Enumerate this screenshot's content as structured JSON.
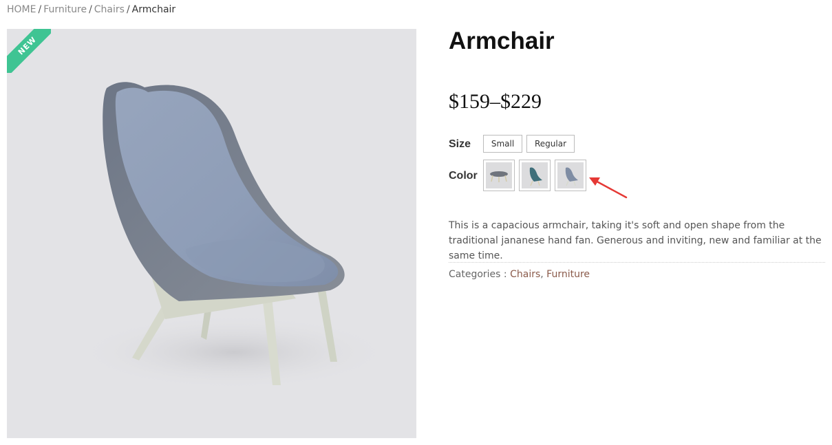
{
  "breadcrumb": {
    "items": [
      "HOME",
      "Furniture",
      "Chairs"
    ],
    "current": "Armchair",
    "separator": "/"
  },
  "badge": {
    "label": "NEW",
    "color": "#3fc493"
  },
  "product": {
    "title": "Armchair",
    "price": "$159–$229",
    "size": {
      "label": "Size",
      "options": [
        "Small",
        "Regular"
      ]
    },
    "color": {
      "label": "Color",
      "swatches": [
        "footstool",
        "armchair-teal",
        "armchair-blue-grey"
      ]
    },
    "description": "This is a capacious armchair, taking it's soft and open shape from the traditional jananese hand fan. Generous and inviting, new and familiar at the same time.",
    "categories": {
      "label": "Categories :",
      "links": [
        "Chairs",
        "Furniture"
      ],
      "separator": ", "
    }
  },
  "colors": {
    "accent_link": "#8a5a4a",
    "annotation_arrow": "#e53935",
    "image_bg": "#e3e3e6"
  }
}
